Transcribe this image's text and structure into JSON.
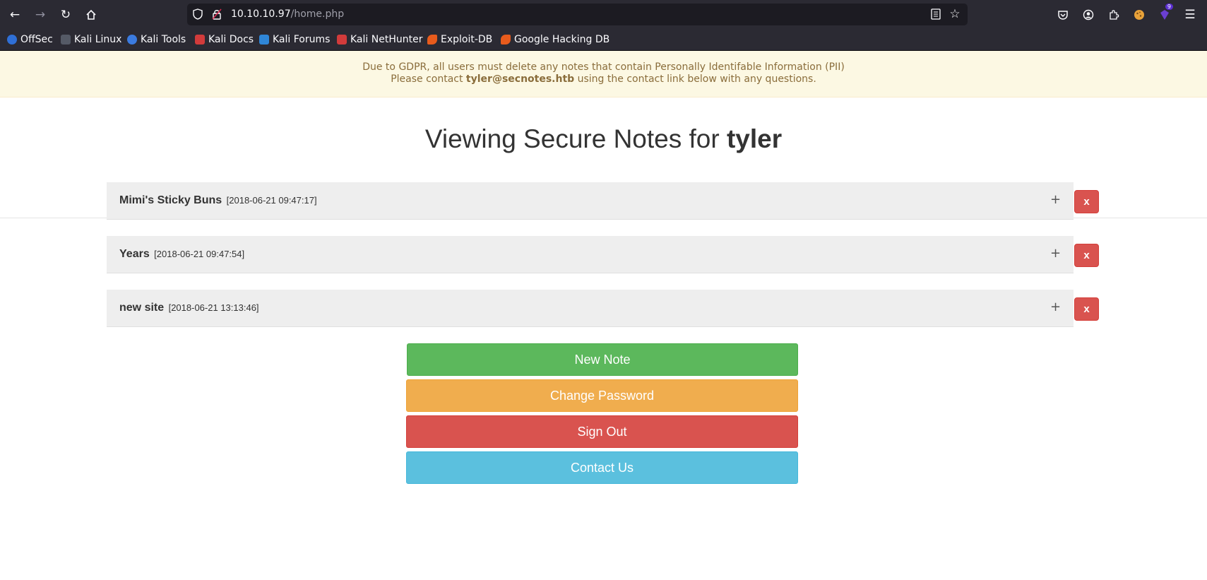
{
  "browser": {
    "url_host": "10.10.10.97",
    "url_path": "/home.php",
    "extension_badge": "9",
    "bookmarks": [
      {
        "label": "OffSec",
        "color": "#2f6fd6"
      },
      {
        "label": "Kali Linux",
        "color": "#555a66"
      },
      {
        "label": "Kali Tools",
        "color": "#3b7be0"
      },
      {
        "label": "Kali Docs",
        "color": "#d23b3b"
      },
      {
        "label": "Kali Forums",
        "color": "#2f86d8"
      },
      {
        "label": "Kali NetHunter",
        "color": "#d23b3b"
      },
      {
        "label": "Exploit-DB",
        "color": "#e85b1c"
      },
      {
        "label": "Google Hacking DB",
        "color": "#e85b1c"
      }
    ]
  },
  "notice": {
    "line1": "Due to GDPR, all users must delete any notes that contain Personally Identifable Information (PII)",
    "line2_prefix": "Please contact ",
    "email": "tyler@secnotes.htb",
    "line2_suffix": " using the contact link below with any questions."
  },
  "heading": {
    "prefix": "Viewing Secure Notes for ",
    "username": "tyler"
  },
  "notes": [
    {
      "title": "Mimi's Sticky Buns",
      "date": "[2018-06-21 09:47:17]",
      "expand": "+",
      "delete": "x"
    },
    {
      "title": "Years",
      "date": "[2018-06-21 09:47:54]",
      "expand": "+",
      "delete": "x"
    },
    {
      "title": "new site",
      "date": "[2018-06-21 13:13:46]",
      "expand": "+",
      "delete": "x"
    }
  ],
  "actions": {
    "new_note": "New Note",
    "change_password": "Change Password",
    "sign_out": "Sign Out",
    "contact_us": "Contact Us"
  },
  "colors": {
    "success": "#5cb85c",
    "warning": "#f0ad4e",
    "danger": "#d9534f",
    "info": "#5bc0de",
    "notice_bg": "#fcf8e3"
  }
}
